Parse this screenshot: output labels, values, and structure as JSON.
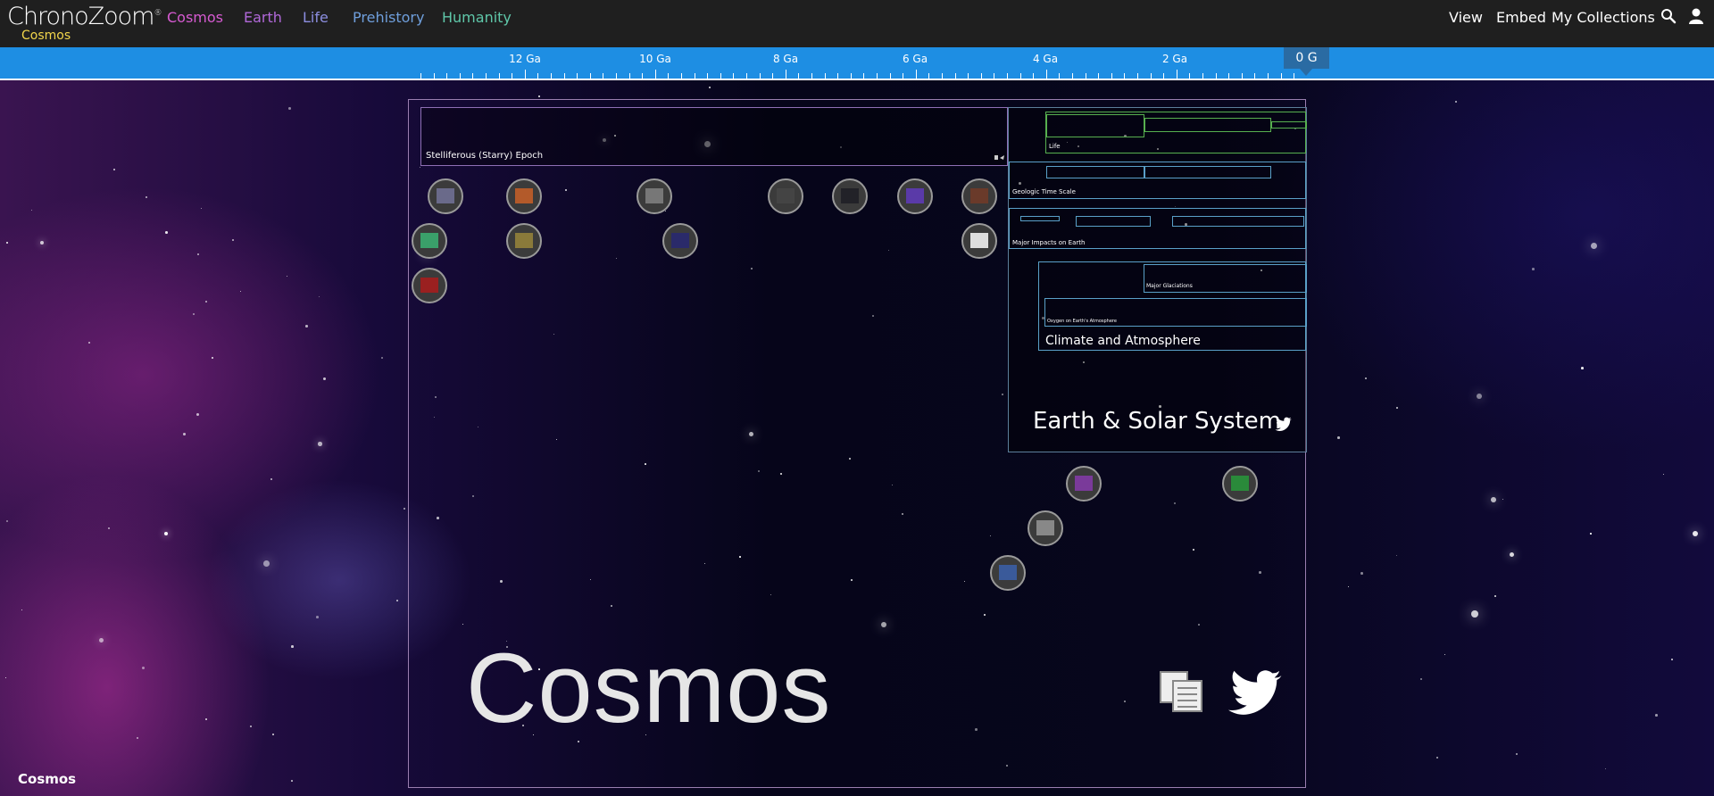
{
  "header": {
    "logo": "ChronoZoom",
    "logo_mark": "®",
    "breadcrumb": "Cosmos",
    "nav": [
      {
        "label": "Cosmos",
        "color": "#d65ad1"
      },
      {
        "label": "Earth",
        "color": "#b168d9"
      },
      {
        "label": "Life",
        "color": "#8c8ee0"
      },
      {
        "label": "Prehistory",
        "color": "#6f9fdc"
      },
      {
        "label": "Humanity",
        "color": "#5fc7a9"
      }
    ],
    "tools": {
      "view": "View",
      "embed": "Embed",
      "collections": "My Collections"
    },
    "icons": {
      "search": "search-icon",
      "user": "user-icon"
    }
  },
  "ruler": {
    "labels": [
      "12 Ga",
      "10 Ga",
      "8 Ga",
      "6 Ga",
      "4 Ga",
      "2 Ga"
    ],
    "marker": "0 G",
    "color": "#1e8ee3"
  },
  "timelines": {
    "cosmos": "Cosmos",
    "stelliferous": "Stelliferous (Starry) Epoch",
    "earth": "Earth & Solar System",
    "life": "Life",
    "geologic": "Geologic Time Scale",
    "impacts": "Major Impacts on Earth",
    "climate": "Climate and Atmosphere",
    "glaciations": "Major Glaciations",
    "oxygen": "Oxygen on Earth's Atmosphere"
  },
  "footer": {
    "label": "Cosmos"
  }
}
